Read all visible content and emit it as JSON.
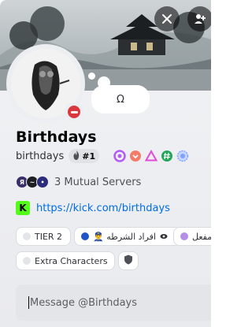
{
  "banner": {
    "mute_button_icon": "mic-muted-icon",
    "add_friend_icon": "add-friend-icon"
  },
  "status": {
    "type": "do-not-disturb",
    "color": "#da373c"
  },
  "custom_status": {
    "text": "Ω"
  },
  "profile": {
    "display_name": "Birthdays",
    "username": "birthdays",
    "rank_label": "#1",
    "rank_icon": "flame-icon"
  },
  "badges": [
    {
      "name": "nitro-badge",
      "color": "#b45cf2"
    },
    {
      "name": "hypesquad-badge",
      "color": "#f47b67"
    },
    {
      "name": "triangle-badge",
      "color": "#e14bd8"
    },
    {
      "name": "hashtag-badge",
      "color": "#23a55a"
    },
    {
      "name": "gem-badge",
      "color": "#7da3ff"
    }
  ],
  "mutual": {
    "text": "3 Mutual Servers",
    "icons": [
      {
        "label": "Я",
        "color": "#3b2f6a"
      },
      {
        "label": "~",
        "color": "#1e1f22"
      },
      {
        "label": "•",
        "color": "#2b2d7c"
      }
    ]
  },
  "link": {
    "icon_letter": "K",
    "url": "https://kick.com/birthdays"
  },
  "roles": [
    {
      "label": "TIER 2",
      "color": "#e3e5e8"
    },
    {
      "label": "👮‍♂️ افراد الشرطه",
      "color": "#1e56c7"
    },
    {
      "label": "مفعل",
      "color": "#b48ee8"
    },
    {
      "label": "Extra Characters",
      "color": "#e3e5e8"
    }
  ],
  "message": {
    "placeholder": "Message @Birthdays"
  }
}
